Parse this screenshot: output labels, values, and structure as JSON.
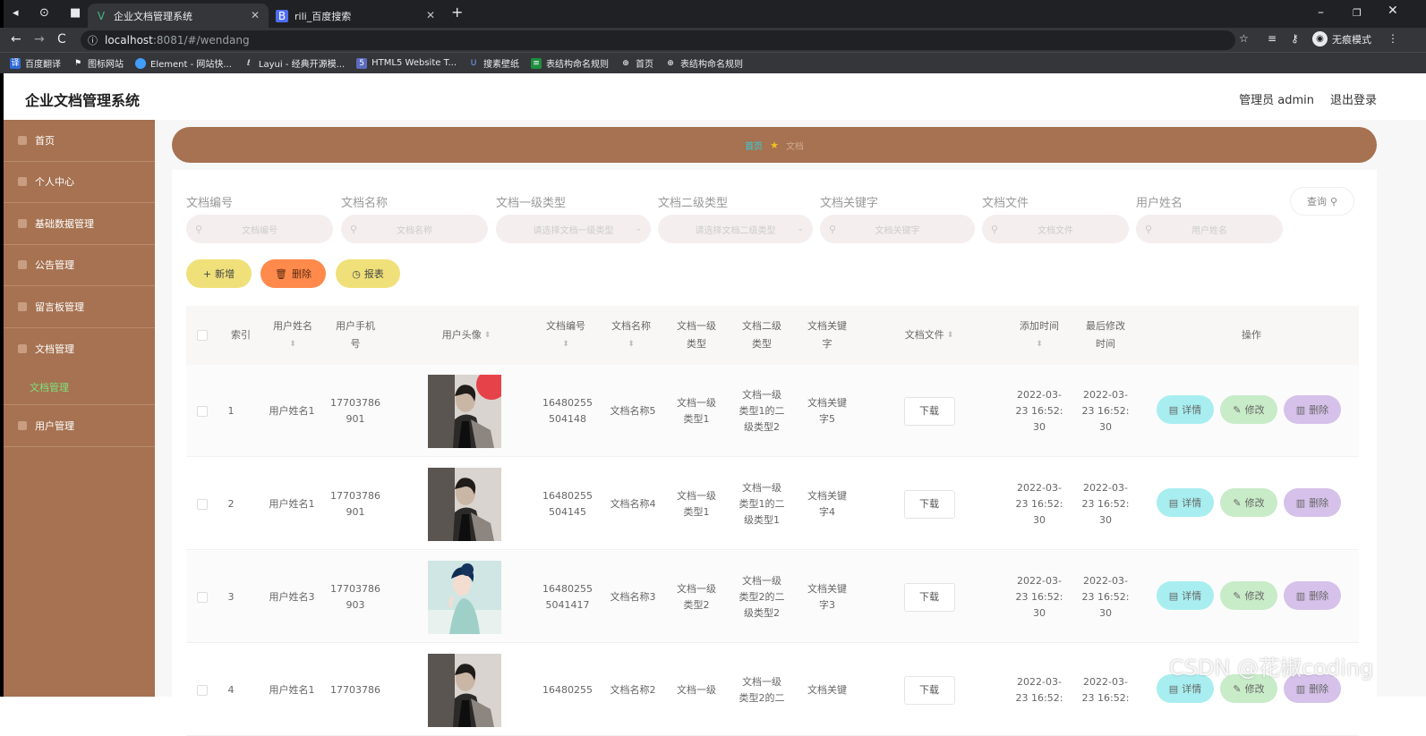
{
  "browser": {
    "tabs": [
      {
        "title": "企业文档管理系统",
        "active": true
      },
      {
        "title": "rili_百度搜索",
        "active": false
      }
    ],
    "url_host": "localhost",
    "url_path": ":8081/#/wendang",
    "incognito_label": "无痕模式",
    "bookmarks": [
      "百度翻译",
      "图标网站",
      "Element - 网站快...",
      "Layui - 经典开源模...",
      "HTML5 Website T...",
      "搜素壁纸",
      "表结构命名规则",
      "首页",
      "表结构命名规则"
    ]
  },
  "header": {
    "title": "企业文档管理系统",
    "user": "管理员 admin",
    "logout": "退出登录"
  },
  "sidebar": {
    "items": [
      "首页",
      "个人中心",
      "基础数据管理",
      "公告管理",
      "留言板管理",
      "文档管理",
      "用户管理"
    ],
    "sub_item": "文档管理"
  },
  "breadcrumb": {
    "home": "首页",
    "current": "文档"
  },
  "filters": {
    "labels": [
      "文档编号",
      "文档名称",
      "文档一级类型",
      "文档二级类型",
      "文档关键字",
      "文档文件",
      "用户姓名"
    ],
    "placeholders": [
      "文档编号",
      "文档名称",
      "请选择文档一级类型",
      "请选择文档二级类型",
      "文档关键字",
      "文档文件",
      "用户姓名"
    ],
    "search_label": "查询"
  },
  "actions": {
    "add": "新增",
    "delete": "删除",
    "report": "报表"
  },
  "table": {
    "headers": {
      "index": "索引",
      "user_name": "用户姓名",
      "user_phone": "用户手机号",
      "avatar": "用户头像",
      "doc_no": "文档编号",
      "doc_name": "文档名称",
      "type1": "文档一级类型",
      "type2": "文档二级类型",
      "keyword": "文档关键字",
      "file": "文档文件",
      "add_time": "添加时间",
      "mod_time": "最后修改时间",
      "ops": "操作"
    },
    "rows": [
      {
        "index": "1",
        "user_name": "用户姓名1",
        "user_phone": "17703786901",
        "doc_no": "16480255504148",
        "doc_name": "文档名称5",
        "type1": "文档一级类型1",
        "type2": "文档一级类型1的二级类型2",
        "keyword": "文档关键字5",
        "file": "下载",
        "add_time": "2022-03-23 16:52:30",
        "mod_time": "2022-03-23 16:52:30",
        "avatar": "man"
      },
      {
        "index": "2",
        "user_name": "用户姓名1",
        "user_phone": "17703786901",
        "doc_no": "16480255504145",
        "doc_name": "文档名称4",
        "type1": "文档一级类型1",
        "type2": "文档一级类型1的二级类型1",
        "keyword": "文档关键字4",
        "file": "下载",
        "add_time": "2022-03-23 16:52:30",
        "mod_time": "2022-03-23 16:52:30",
        "avatar": "man"
      },
      {
        "index": "3",
        "user_name": "用户姓名3",
        "user_phone": "17703786903",
        "doc_no": "164802555041417",
        "doc_name": "文档名称3",
        "type1": "文档一级类型2",
        "type2": "文档一级类型2的二级类型2",
        "keyword": "文档关键字3",
        "file": "下载",
        "add_time": "2022-03-23 16:52:30",
        "mod_time": "2022-03-23 16:52:30",
        "avatar": "woman"
      },
      {
        "index": "4",
        "user_name": "用户姓名1",
        "user_phone": "17703786",
        "doc_no": "16480255",
        "doc_name": "文档名称2",
        "type1": "文档一级",
        "type2": "文档一级类型2的二",
        "keyword": "文档关键",
        "file": "下载",
        "add_time": "2022-03-23 16:52:",
        "mod_time": "2022-03-23 16:52:",
        "avatar": "man"
      }
    ],
    "op_labels": {
      "detail": "详情",
      "edit": "修改",
      "delete": "删除"
    }
  },
  "watermark": "CSDN @花椒coding",
  "colors": {
    "sidebar": "#a67251",
    "breadcrumb_bg": "#a67251",
    "add_btn": "#f0e07a",
    "del_btn": "#ff8a4c",
    "report_btn": "#f0e07a",
    "detail_btn": "#a8eef0",
    "edit_btn": "#c8ebc8",
    "op_del_btn": "#d6c1ea"
  }
}
